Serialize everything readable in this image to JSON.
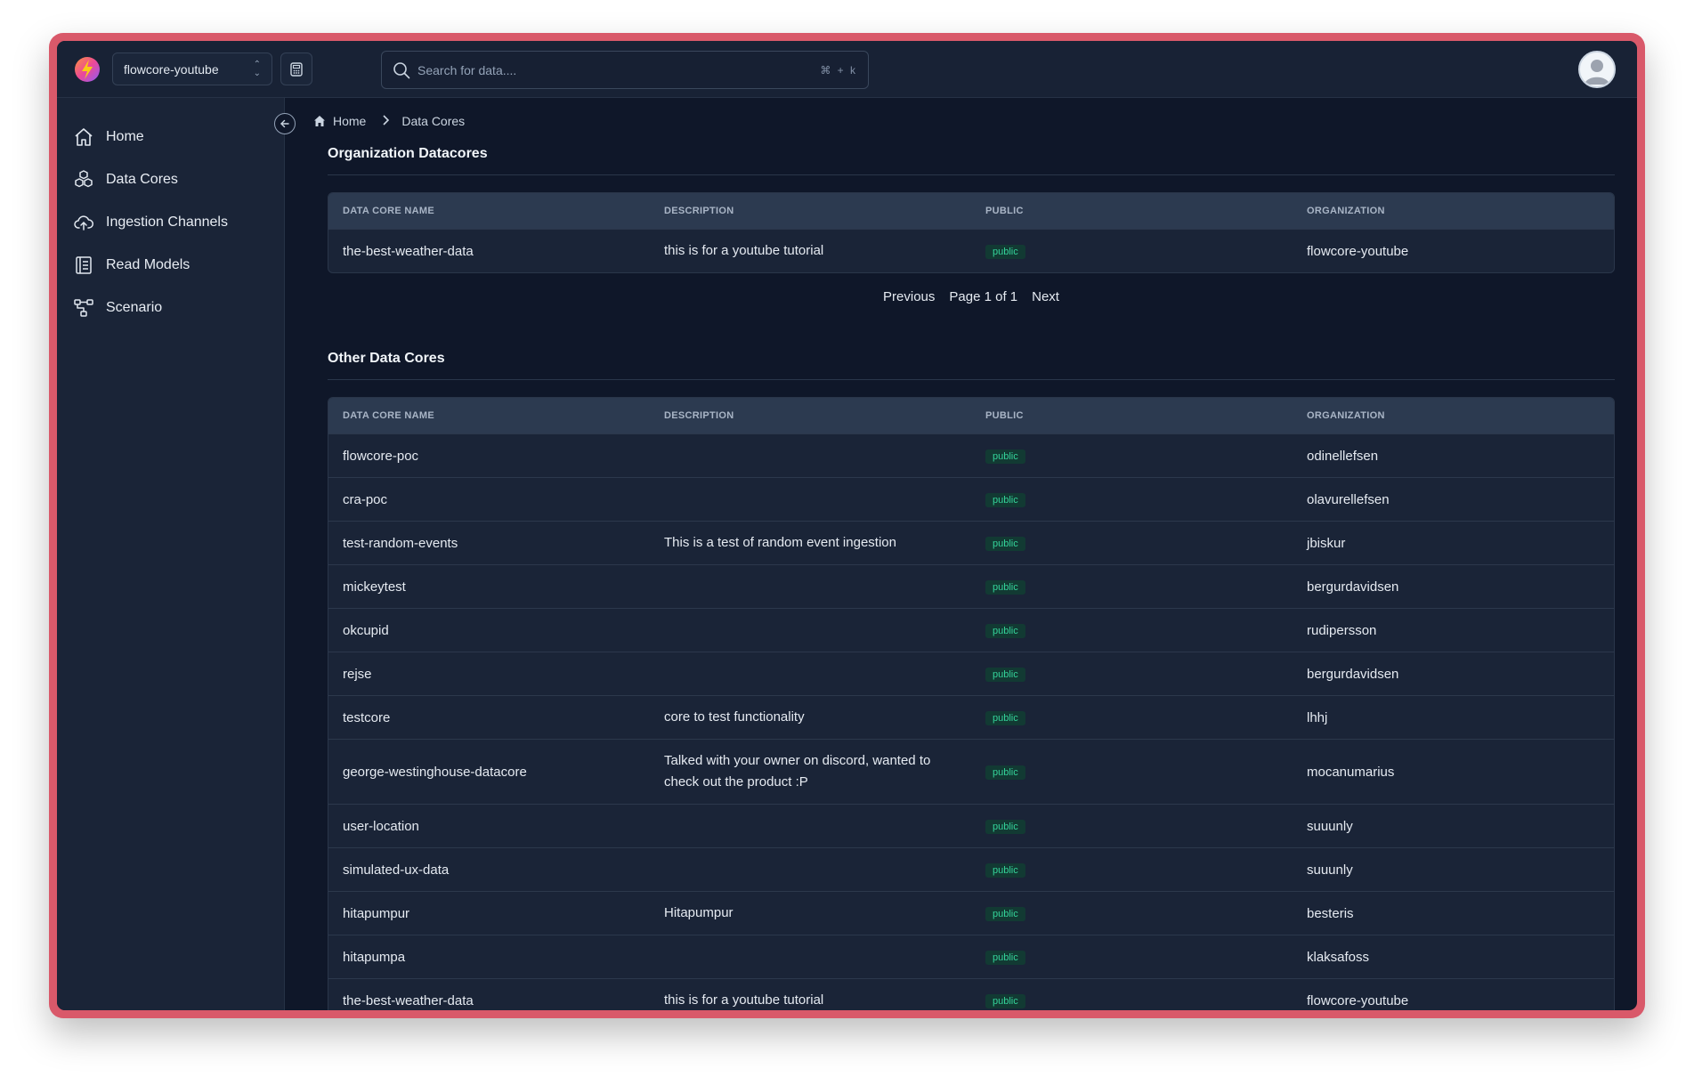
{
  "header": {
    "project": "flowcore-youtube",
    "search_placeholder": "Search for data....",
    "search_shortcut": "⌘ + k"
  },
  "sidebar": {
    "items": [
      {
        "label": "Home",
        "icon": "home-icon"
      },
      {
        "label": "Data Cores",
        "icon": "cubes-icon"
      },
      {
        "label": "Ingestion Channels",
        "icon": "cloud-upload-icon"
      },
      {
        "label": "Read Models",
        "icon": "book-icon"
      },
      {
        "label": "Scenario",
        "icon": "workflow-icon"
      }
    ]
  },
  "breadcrumb": {
    "home": "Home",
    "current": "Data Cores"
  },
  "columns": [
    "DATA CORE NAME",
    "DESCRIPTION",
    "PUBLIC",
    "ORGANIZATION"
  ],
  "org_section": {
    "title": "Organization Datacores",
    "rows": [
      {
        "name": "the-best-weather-data",
        "description": "this is for a youtube tutorial",
        "public": "public",
        "organization": "flowcore-youtube"
      }
    ],
    "pager": {
      "previous": "Previous",
      "page": "Page 1 of 1",
      "next": "Next"
    }
  },
  "other_section": {
    "title": "Other Data Cores",
    "rows": [
      {
        "name": "flowcore-poc",
        "description": "",
        "public": "public",
        "organization": "odinellefsen"
      },
      {
        "name": "cra-poc",
        "description": "",
        "public": "public",
        "organization": "olavurellefsen"
      },
      {
        "name": "test-random-events",
        "description": "This is a test of random event ingestion",
        "public": "public",
        "organization": "jbiskur"
      },
      {
        "name": "mickeytest",
        "description": "",
        "public": "public",
        "organization": "bergurdavidsen"
      },
      {
        "name": "okcupid",
        "description": "",
        "public": "public",
        "organization": "rudipersson"
      },
      {
        "name": "rejse",
        "description": "",
        "public": "public",
        "organization": "bergurdavidsen"
      },
      {
        "name": "testcore",
        "description": "core to test functionality",
        "public": "public",
        "organization": "lhhj"
      },
      {
        "name": "george-westinghouse-datacore",
        "description": "Talked with your owner on discord, wanted to check out the product :P",
        "public": "public",
        "organization": "mocanumarius"
      },
      {
        "name": "user-location",
        "description": "",
        "public": "public",
        "organization": "suuunly"
      },
      {
        "name": "simulated-ux-data",
        "description": "",
        "public": "public",
        "organization": "suuunly"
      },
      {
        "name": "hitapumpur",
        "description": "Hitapumpur",
        "public": "public",
        "organization": "besteris"
      },
      {
        "name": "hitapumpa",
        "description": "",
        "public": "public",
        "organization": "klaksafoss"
      },
      {
        "name": "the-best-weather-data",
        "description": "this is for a youtube tutorial",
        "public": "public",
        "organization": "flowcore-youtube"
      }
    ]
  },
  "colors": {
    "frame": "#d9596a",
    "background": "#0f1729",
    "sidebar": "#1a2437",
    "badge_text": "#34d399",
    "badge_bg": "#123a33"
  }
}
